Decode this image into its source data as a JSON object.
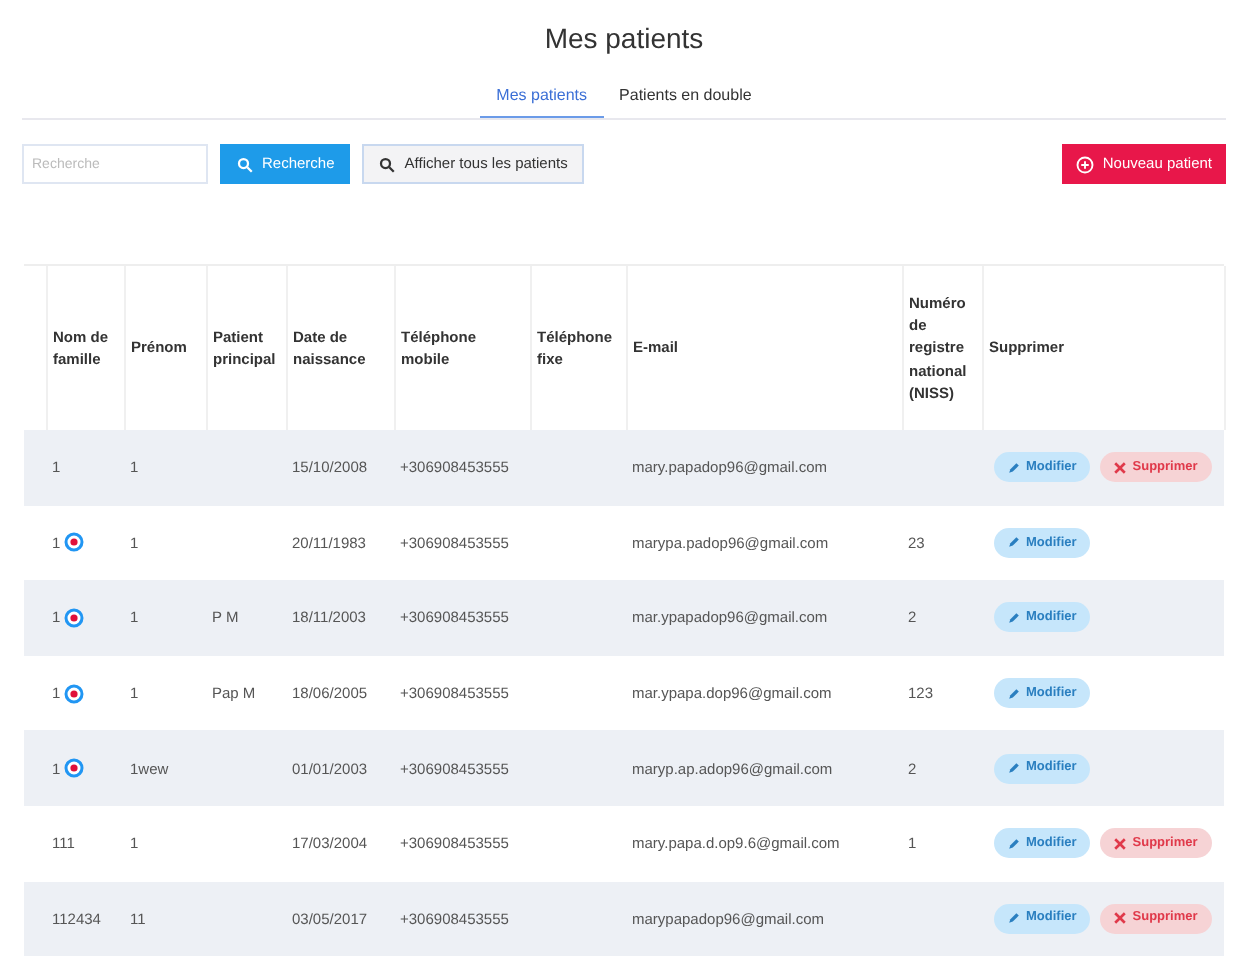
{
  "title": "Mes patients",
  "tabs": [
    {
      "label": "Mes patients",
      "selected": true
    },
    {
      "label": "Patients en double",
      "selected": false
    }
  ],
  "search": {
    "placeholder": "Recherche"
  },
  "buttons": {
    "search": "Recherche",
    "show_all": "Afficher tous les patients",
    "new_patient": "Nouveau patient"
  },
  "table": {
    "columns": [
      "Nom de famille",
      "Prénom",
      "Patient principal",
      "Date de naissance",
      "Téléphone mobile",
      "Téléphone fixe",
      "E-mail",
      "Numéro de registre national (NISS)",
      "Supprimer"
    ],
    "rows": [
      {
        "last_name": "1",
        "marked": false,
        "first_name": "1",
        "main_patient": "",
        "birth_date": "15/10/2008",
        "mobile": "+306908453555",
        "email": "mary.papadop96@gmail.com",
        "niss": "",
        "edit": "Modifier",
        "delete": "Supprimer"
      },
      {
        "last_name": "1",
        "marked": true,
        "first_name": "1",
        "main_patient": "",
        "birth_date": "20/11/1983",
        "mobile": "+306908453555",
        "email": "marypa.padop96@gmail.com",
        "niss": "23",
        "edit": "Modifier"
      },
      {
        "last_name": "1",
        "marked": true,
        "first_name": "1",
        "main_patient": "P M",
        "birth_date": "18/11/2003",
        "mobile": "+306908453555",
        "email": "mar.ypapadop96@gmail.com",
        "niss": "2",
        "edit": "Modifier"
      },
      {
        "last_name": "1",
        "marked": true,
        "first_name": "1",
        "main_patient": "Pap M",
        "birth_date": "18/06/2005",
        "mobile": "+306908453555",
        "email": "mar.ypapa.dop96@gmail.com",
        "niss": "123",
        "edit": "Modifier"
      },
      {
        "last_name": "1",
        "marked": true,
        "first_name": "1wew",
        "main_patient": "",
        "birth_date": "01/01/2003",
        "mobile": "+306908453555",
        "email": "maryp.ap.adop96@gmail.com",
        "niss": "2",
        "edit": "Modifier"
      },
      {
        "last_name": "111",
        "marked": false,
        "first_name": "1",
        "main_patient": "",
        "birth_date": "17/03/2004",
        "mobile": "+306908453555",
        "email": "mary.papa.d.op9.6@gmail.com",
        "niss": "1",
        "edit": "Modifier",
        "delete": "Supprimer"
      },
      {
        "last_name": "112434",
        "marked": false,
        "first_name": "11",
        "main_patient": "",
        "birth_date": "03/05/2017",
        "mobile": "+306908453555",
        "email": "marypapadop96@gmail.com",
        "niss": "",
        "edit": "Modifier",
        "delete": "Supprimer"
      }
    ]
  }
}
